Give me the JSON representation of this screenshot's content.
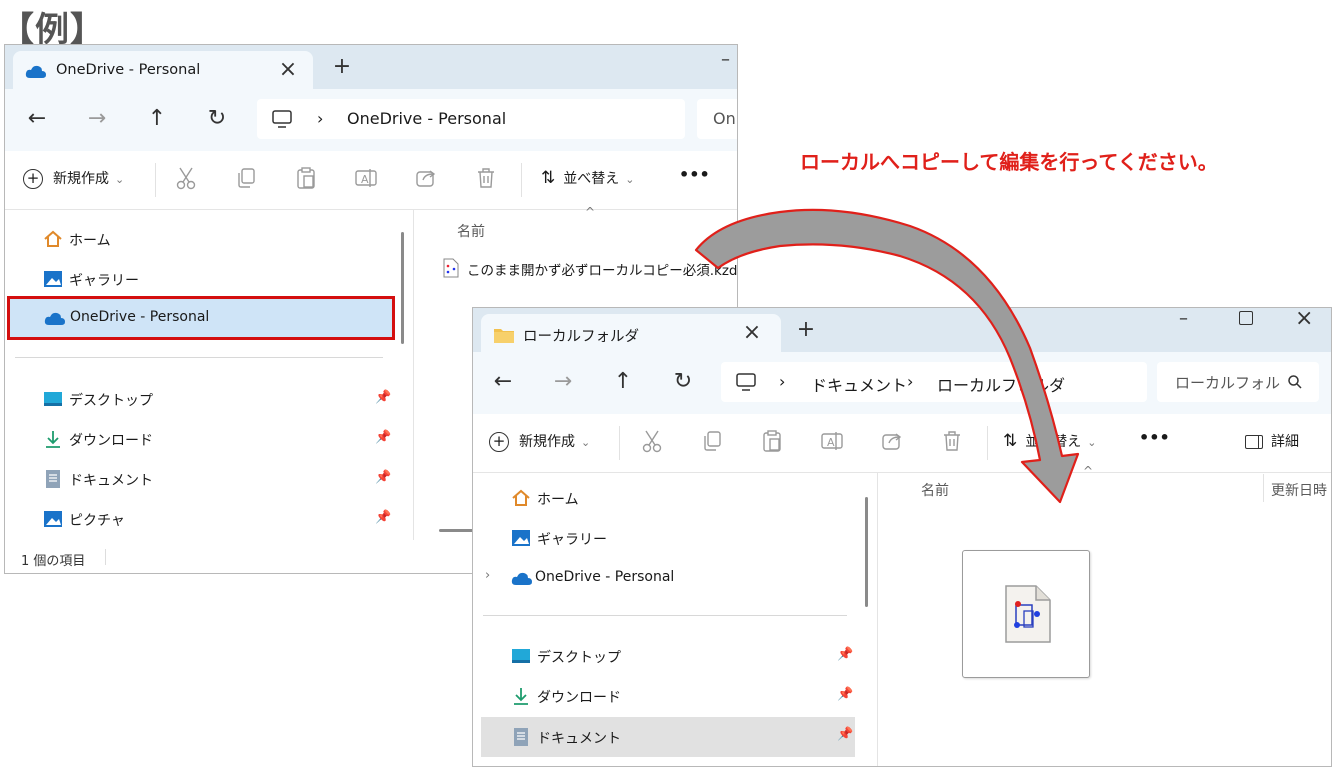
{
  "heading": "【例】",
  "caption": "ローカルへコピーして編集を行ってください。",
  "colors": {
    "accent": "#e0201a",
    "selection": "#cfe4f7",
    "highlight_box": "#d40f0f"
  },
  "win1": {
    "tab_title": "OneDrive - Personal",
    "address": {
      "location": "OneDrive - Personal",
      "search_partial": "On"
    },
    "toolbar": {
      "new_label": "新規作成",
      "sort_label": "並べ替え",
      "more": "•••"
    },
    "sidebar": {
      "items": [
        {
          "label": "ホーム",
          "icon": "home-icon"
        },
        {
          "label": "ギャラリー",
          "icon": "gallery-icon"
        },
        {
          "label": "OneDrive - Personal",
          "icon": "cloud-icon"
        },
        {
          "label": "デスクトップ",
          "icon": "desktop-icon"
        },
        {
          "label": "ダウンロード",
          "icon": "download-icon"
        },
        {
          "label": "ドキュメント",
          "icon": "document-icon"
        },
        {
          "label": "ピクチャ",
          "icon": "picture-icon"
        }
      ]
    },
    "column_name": "名前",
    "files": [
      {
        "name": "このまま開かず必ずローカルコピー必須.kzd",
        "icon": "kzd-file-icon"
      }
    ],
    "status": "1 個の項目"
  },
  "win2": {
    "tab_title": "ローカルフォルダ",
    "address": {
      "seg1": "ドキュメント",
      "seg2": "ローカルフォルダ",
      "search": "ローカルフォル"
    },
    "toolbar": {
      "new_label": "新規作成",
      "sort_label": "並べ替え",
      "more": "•••",
      "details_label": "詳細"
    },
    "sidebar": {
      "items": [
        {
          "label": "ホーム",
          "icon": "home-icon"
        },
        {
          "label": "ギャラリー",
          "icon": "gallery-icon"
        },
        {
          "label": "OneDrive - Personal",
          "icon": "cloud-icon"
        },
        {
          "label": "デスクトップ",
          "icon": "desktop-icon"
        },
        {
          "label": "ダウンロード",
          "icon": "download-icon"
        },
        {
          "label": "ドキュメント",
          "icon": "document-icon"
        }
      ]
    },
    "column_name": "名前",
    "column_modified": "更新日時"
  }
}
